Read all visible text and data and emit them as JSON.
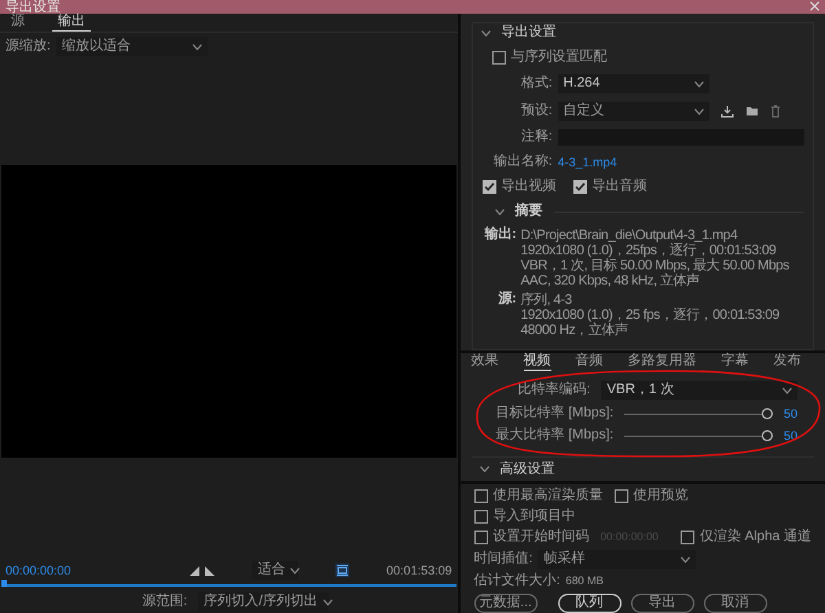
{
  "window": {
    "title": "导出设置"
  },
  "left_tabs": [
    {
      "label": "源",
      "selected": false
    },
    {
      "label": "输出",
      "selected": true
    }
  ],
  "source_scaling": {
    "label": "源缩放:",
    "value": "缩放以适合"
  },
  "timeline": {
    "current_time": "00:00:00:00",
    "fit": "适合",
    "end_time": "00:01:53:09",
    "playhead": {
      "level": 0
    },
    "range_label": "源范围:",
    "range_value": "序列切入/序列切出"
  },
  "export_settings": {
    "heading": "导出设置",
    "expanded": true,
    "match_sequence": {
      "label": "与序列设置匹配",
      "checked": false
    },
    "format": {
      "label": "格式:",
      "value": "H.264"
    },
    "preset": {
      "label": "预设:",
      "value": "自定义"
    },
    "comments": {
      "label": "注释:"
    },
    "output_name": {
      "label": "输出名称:",
      "value": "4-3_1.mp4"
    },
    "exports": [
      {
        "label": "导出视频",
        "checked": true
      },
      {
        "label": "导出音频",
        "checked": true
      }
    ],
    "summary": {
      "heading": "摘要",
      "expanded": true,
      "groups": [
        {
          "label": "输出:",
          "lines": [
            "D:\\Project\\Brain_die\\Output\\4-3_1.mp4",
            "1920x1080 (1.0)，25fps，逐行，00:01:53:09",
            "VBR，1 次, 目标 50.00 Mbps, 最大 50.00 Mbps",
            "AAC, 320 Kbps, 48  kHz, 立体声"
          ]
        },
        {
          "label": "源:",
          "lines": [
            "序列, 4-3",
            "1920x1080 (1.0)，25 fps，逐行，00:01:53:09",
            "48000 Hz，立体声"
          ]
        }
      ]
    }
  },
  "tabs": [
    {
      "label": "效果",
      "selected": false
    },
    {
      "label": "视频",
      "selected": true
    },
    {
      "label": "音频",
      "selected": false
    },
    {
      "label": "多路复用器",
      "selected": false
    },
    {
      "label": "字幕",
      "selected": false
    },
    {
      "label": "发布",
      "selected": false
    }
  ],
  "video": {
    "bitrate_encoding": {
      "label": "比特率编码:",
      "value": "VBR，1 次"
    },
    "sliders": [
      {
        "label": "目标比特率 [Mbps]:",
        "level": 1,
        "reading": "50"
      },
      {
        "label": "最大比特率 [Mbps]:",
        "level": 1,
        "reading": "50"
      }
    ]
  },
  "advanced": {
    "heading": "高级设置",
    "expanded": true
  },
  "options": {
    "row1": [
      {
        "label": "使用最高渲染质量",
        "checked": false
      },
      {
        "label": "使用预览",
        "checked": false
      }
    ],
    "import": {
      "label": "导入到项目中",
      "checked": false
    },
    "timecode": {
      "label": "设置开始时间码",
      "checked": false,
      "value": "00:00:00:00"
    },
    "alpha": {
      "label": "仅渲染 Alpha 通道",
      "checked": false
    },
    "interpolation": {
      "label": "时间插值:",
      "value": "帧采样"
    },
    "file_size": {
      "label": "估计文件大小:",
      "value": "680 MB"
    }
  },
  "buttons": [
    {
      "label": "元数据...",
      "primary": false
    },
    {
      "label": "队列",
      "primary": true
    },
    {
      "label": "导出",
      "primary": false
    },
    {
      "label": "取消",
      "primary": false
    }
  ]
}
